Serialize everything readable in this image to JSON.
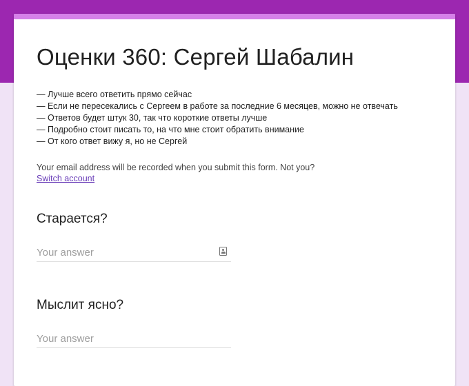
{
  "form": {
    "title": "Оценки 360: Сергей Шабалин",
    "description_lines": [
      "— Лучше всего ответить прямо сейчас",
      "— Если не пересекались с Сергеем в работе за последние 6 месяцев, можно не отвечать",
      "— Ответов будет штук 30, так что короткие ответы лучше",
      "— Подробно стоит писать то, на что мне стоит обратить внимание",
      "— От кого ответ вижу я, но не Сергей"
    ],
    "email_note": "Your email address will be recorded when you submit this form. Not you?",
    "switch_account_label": "Switch account"
  },
  "questions": [
    {
      "title": "Старается?",
      "placeholder": "Your answer",
      "icon": "autofill-contact-icon"
    },
    {
      "title": "Мыслит ясно?",
      "placeholder": "Your answer"
    }
  ],
  "colors": {
    "header_band": "#9c27b0",
    "card_accent": "#d580e8",
    "page_background": "#f0e3f6",
    "link": "#673ab7"
  }
}
